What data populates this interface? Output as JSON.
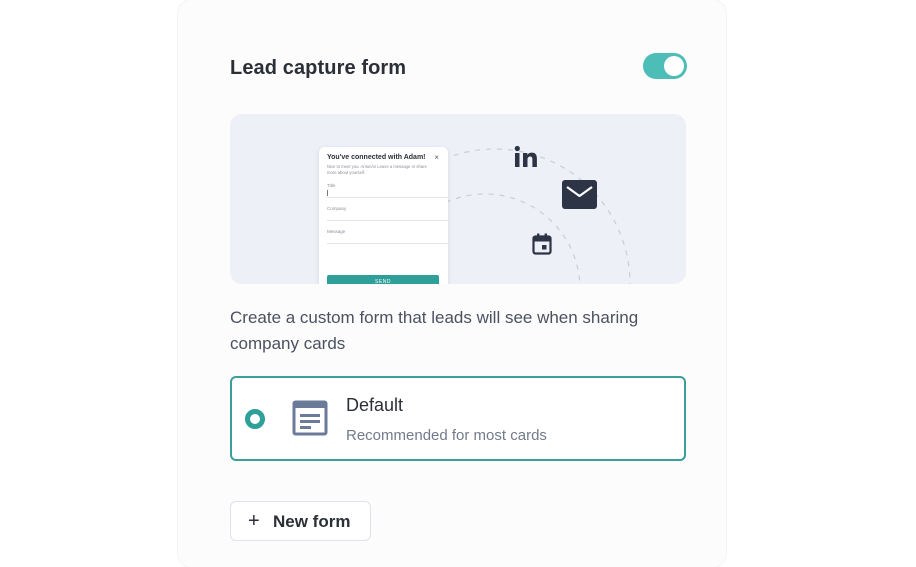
{
  "header": {
    "title": "Lead capture form",
    "toggle_on": true
  },
  "preview": {
    "form_title": "You've connected with Adam!",
    "form_close": "×",
    "form_subtitle": "Nice to meet you. Anton/u! Leave a message or share more about yourself.",
    "fields": [
      "Title",
      "Company",
      "Message"
    ],
    "send_label": "SEND",
    "icons": [
      "linkedin-icon",
      "mail-icon",
      "calendar-icon"
    ]
  },
  "description": "Create a custom form that leads will see when sharing company cards",
  "option": {
    "title": "Default",
    "subtitle": "Recommended for most cards",
    "selected": true,
    "icon": "form-layout-icon"
  },
  "new_form": {
    "icon": "+",
    "label": "New form"
  },
  "colors": {
    "accent": "#4dbdb8",
    "accent_dark": "#2f9f99",
    "text": "#2b2f36",
    "muted": "#727a8b",
    "preview_bg": "#eef0f8"
  }
}
